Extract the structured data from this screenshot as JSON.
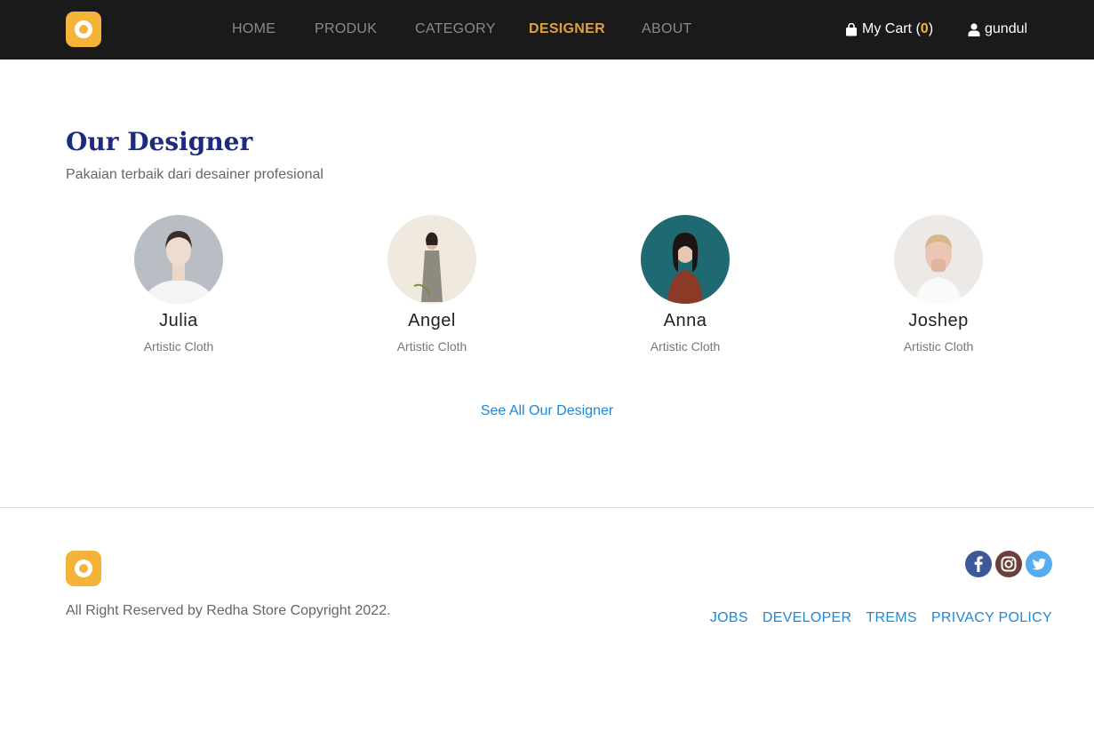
{
  "nav": {
    "links": [
      "HOME",
      "PRODUK",
      "CATEGORY",
      "DESIGNER",
      "ABOUT"
    ],
    "active": "DESIGNER",
    "cart_label": "My Cart (",
    "cart_count": "0",
    "cart_close": ")",
    "username": "gundul"
  },
  "section": {
    "title": "Our Designer",
    "subtitle": "Pakaian terbaik dari desainer profesional"
  },
  "designers": [
    {
      "name": "Julia",
      "role": "Artistic Cloth"
    },
    {
      "name": "Angel",
      "role": "Artistic Cloth"
    },
    {
      "name": "Anna",
      "role": "Artistic Cloth"
    },
    {
      "name": "Joshep",
      "role": "Artistic Cloth"
    }
  ],
  "see_all": "See All Our Designer",
  "footer": {
    "copyright": "All Right Reserved by Redha Store Copyright 2022.",
    "links": [
      "JOBS",
      "DEVELOPER",
      "TREMS",
      "PRIVACY POLICY"
    ],
    "social": [
      "facebook-icon",
      "instagram-icon",
      "twitter-icon"
    ]
  },
  "colors": {
    "navbar_bg": "#1a1a1a",
    "accent": "#f6b33a",
    "active_nav": "#e0a040",
    "title": "#1e2a80",
    "link": "#1e88d8"
  }
}
